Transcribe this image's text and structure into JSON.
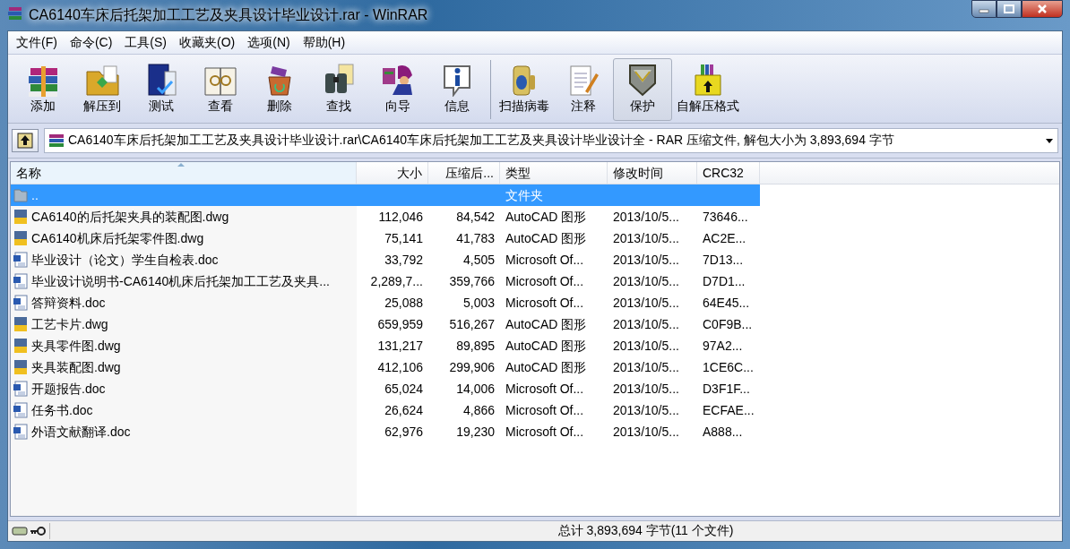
{
  "window": {
    "title": "CA6140车床后托架加工工艺及夹具设计毕业设计.rar - WinRAR"
  },
  "menu": [
    "文件(F)",
    "命令(C)",
    "工具(S)",
    "收藏夹(O)",
    "选项(N)",
    "帮助(H)"
  ],
  "toolbar": [
    {
      "label": "添加",
      "kind": "add",
      "hot": false
    },
    {
      "label": "解压到",
      "kind": "extract",
      "hot": false
    },
    {
      "label": "测试",
      "kind": "test",
      "hot": false
    },
    {
      "label": "查看",
      "kind": "view",
      "hot": false
    },
    {
      "label": "删除",
      "kind": "delete",
      "hot": false
    },
    {
      "label": "查找",
      "kind": "find",
      "hot": false
    },
    {
      "label": "向导",
      "kind": "wizard",
      "hot": false
    },
    {
      "label": "信息",
      "kind": "info",
      "hot": false
    },
    {
      "label": "扫描病毒",
      "kind": "scan",
      "hot": false
    },
    {
      "label": "注释",
      "kind": "comment",
      "hot": false
    },
    {
      "label": "保护",
      "kind": "protect",
      "hot": true
    },
    {
      "label": "自解压格式",
      "kind": "sfx",
      "hot": false
    }
  ],
  "address": {
    "path": "CA6140车床后托架加工工艺及夹具设计毕业设计.rar\\CA6140车床后托架加工工艺及夹具设计毕业设计全 - RAR 压缩文件, 解包大小为 3,893,694 字节"
  },
  "table": {
    "columns": [
      "名称",
      "大小",
      "压缩后...",
      "类型",
      "修改时间",
      "CRC32"
    ],
    "rows": [
      {
        "kind": "folder",
        "selected": true,
        "cells": [
          "..",
          "",
          "",
          "文件夹",
          "",
          ""
        ]
      },
      {
        "kind": "dwg",
        "selected": false,
        "cells": [
          "CA6140的后托架夹具的装配图.dwg",
          "112,046",
          "84,542",
          "AutoCAD 图形",
          "2013/10/5...",
          "73646..."
        ]
      },
      {
        "kind": "dwg",
        "selected": false,
        "cells": [
          "CA6140机床后托架零件图.dwg",
          "75,141",
          "41,783",
          "AutoCAD 图形",
          "2013/10/5...",
          "AC2E..."
        ]
      },
      {
        "kind": "doc",
        "selected": false,
        "cells": [
          "毕业设计（论文）学生自检表.doc",
          "33,792",
          "4,505",
          "Microsoft Of...",
          "2013/10/5...",
          "7D13..."
        ]
      },
      {
        "kind": "doc",
        "selected": false,
        "cells": [
          "毕业设计说明书-CA6140机床后托架加工工艺及夹具...",
          "2,289,7...",
          "359,766",
          "Microsoft Of...",
          "2013/10/5...",
          "D7D1..."
        ]
      },
      {
        "kind": "doc",
        "selected": false,
        "cells": [
          "答辩资料.doc",
          "25,088",
          "5,003",
          "Microsoft Of...",
          "2013/10/5...",
          "64E45..."
        ]
      },
      {
        "kind": "dwg",
        "selected": false,
        "cells": [
          "工艺卡片.dwg",
          "659,959",
          "516,267",
          "AutoCAD 图形",
          "2013/10/5...",
          "C0F9B..."
        ]
      },
      {
        "kind": "dwg",
        "selected": false,
        "cells": [
          "夹具零件图.dwg",
          "131,217",
          "89,895",
          "AutoCAD 图形",
          "2013/10/5...",
          "97A2..."
        ]
      },
      {
        "kind": "dwg",
        "selected": false,
        "cells": [
          "夹具装配图.dwg",
          "412,106",
          "299,906",
          "AutoCAD 图形",
          "2013/10/5...",
          "1CE6C..."
        ]
      },
      {
        "kind": "doc",
        "selected": false,
        "cells": [
          "开题报告.doc",
          "65,024",
          "14,006",
          "Microsoft Of...",
          "2013/10/5...",
          "D3F1F..."
        ]
      },
      {
        "kind": "doc",
        "selected": false,
        "cells": [
          "任务书.doc",
          "26,624",
          "4,866",
          "Microsoft Of...",
          "2013/10/5...",
          "ECFAE..."
        ]
      },
      {
        "kind": "doc",
        "selected": false,
        "cells": [
          "外语文献翻译.doc",
          "62,976",
          "19,230",
          "Microsoft Of...",
          "2013/10/5...",
          "A888..."
        ]
      }
    ]
  },
  "status_bar": {
    "total": "总计 3,893,694 字节(11 个文件)"
  }
}
